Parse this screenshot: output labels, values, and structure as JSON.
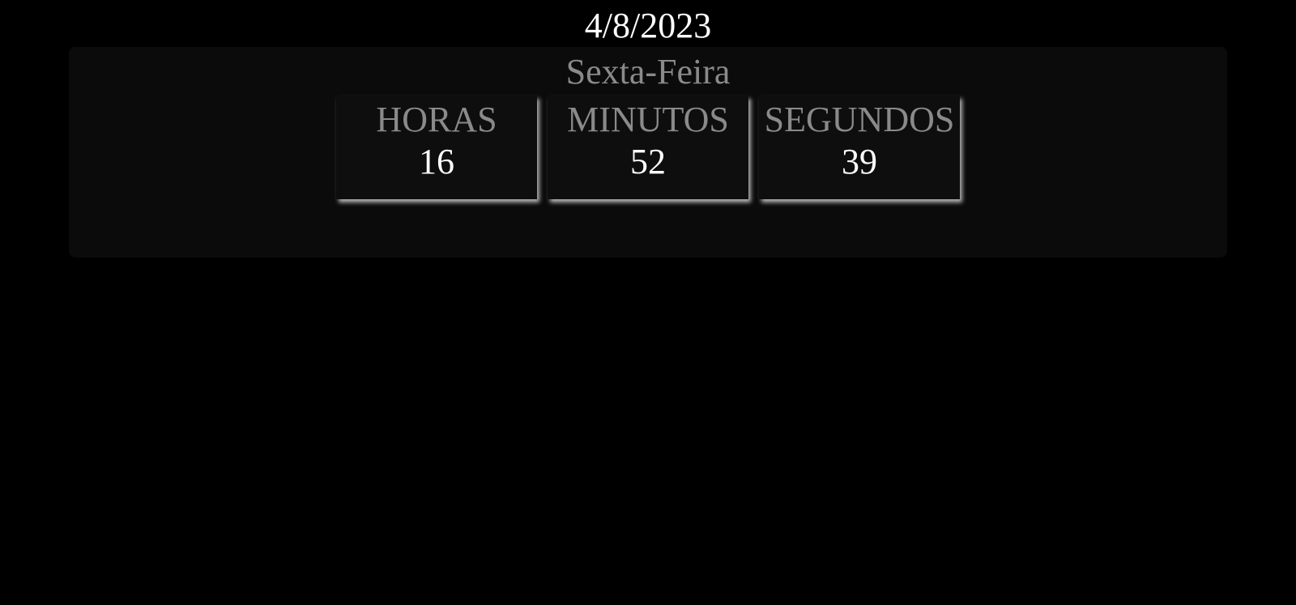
{
  "clock": {
    "date": "4/8/2023",
    "weekday": "Sexta-Feira",
    "units": [
      {
        "label": "HORAS",
        "value": "16"
      },
      {
        "label": "MINUTOS",
        "value": "52"
      },
      {
        "label": "SEGUNDOS",
        "value": "39"
      }
    ]
  },
  "colors": {
    "background": "#000000",
    "panel": "#0b0b0b",
    "label_text": "#8a8a8a",
    "value_text": "#ffffff"
  }
}
